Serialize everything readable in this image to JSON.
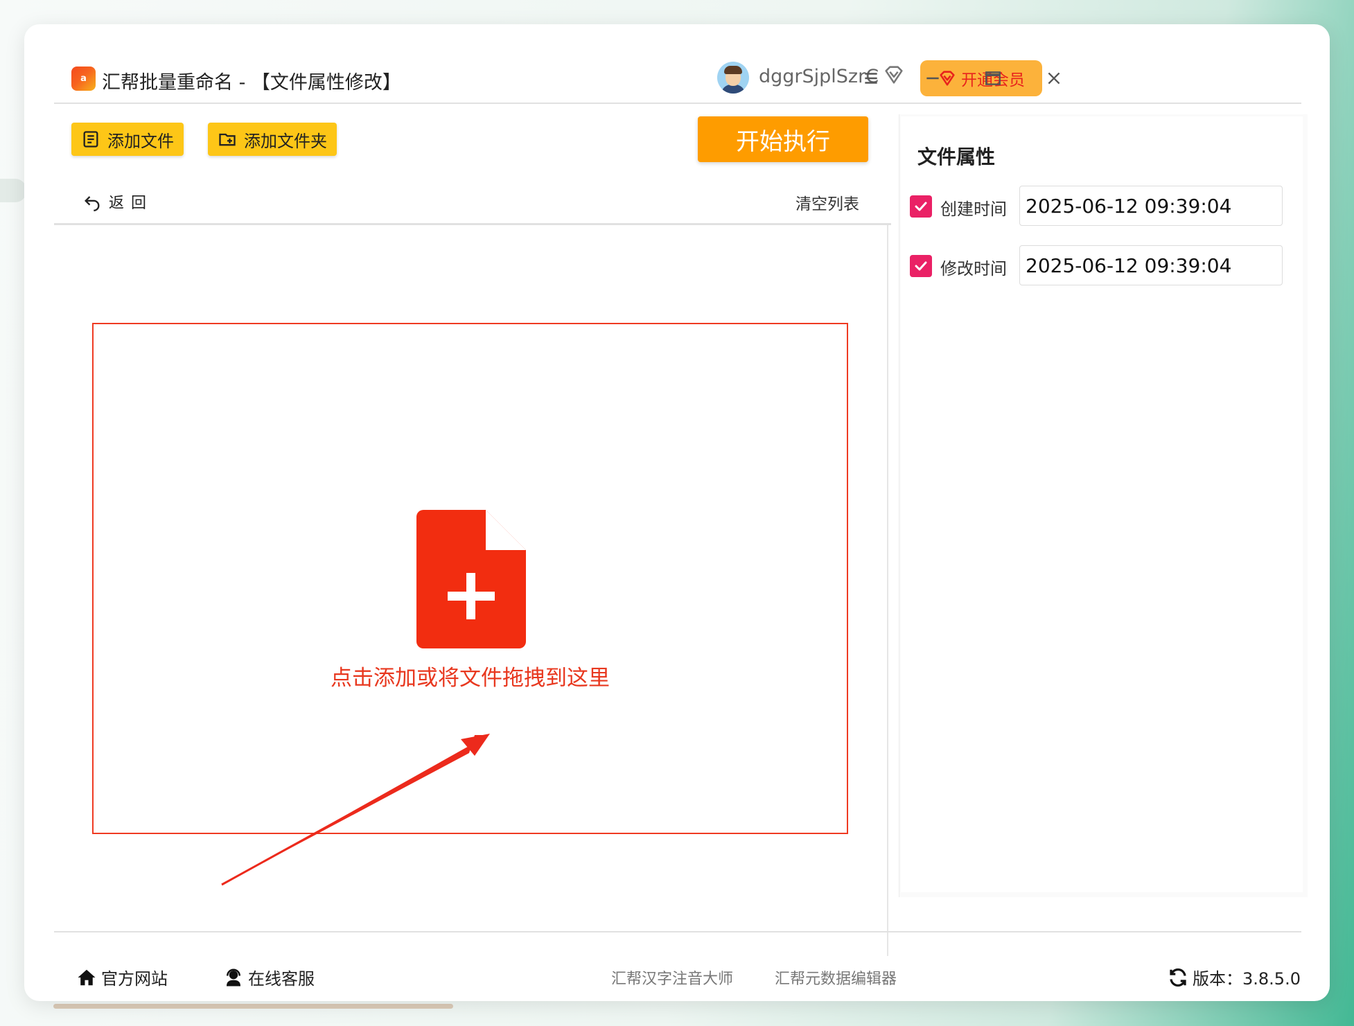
{
  "app": {
    "logo_text": "a",
    "title": "汇帮批量重命名 - 【文件属性修改】"
  },
  "user": {
    "name": "dggrSjplSzrC",
    "vip_label": "开通会员"
  },
  "toolbar": {
    "add_file_label": "添加文件",
    "add_folder_label": "添加文件夹",
    "start_label": "开始执行",
    "back_label": "返回",
    "clear_label": "清空列表"
  },
  "dropzone": {
    "text": "点击添加或将文件拖拽到这里"
  },
  "panel": {
    "title": "文件属性",
    "created": {
      "label": "创建时间",
      "value": "2025-06-12 09:39:04",
      "checked": true
    },
    "modified": {
      "label": "修改时间",
      "value": "2025-06-12 09:39:04",
      "checked": true
    }
  },
  "footer": {
    "website_label": "官方网站",
    "support_label": "在线客服",
    "app1_label": "汇帮汉字注音大师",
    "app2_label": "汇帮元数据编辑器",
    "version_label": "版本：3.8.5.0"
  },
  "colors": {
    "accent_yellow": "#fdc617",
    "start_orange": "#fe9c00",
    "drop_red": "#ef3a22",
    "checkbox_pink": "#ea2165"
  }
}
